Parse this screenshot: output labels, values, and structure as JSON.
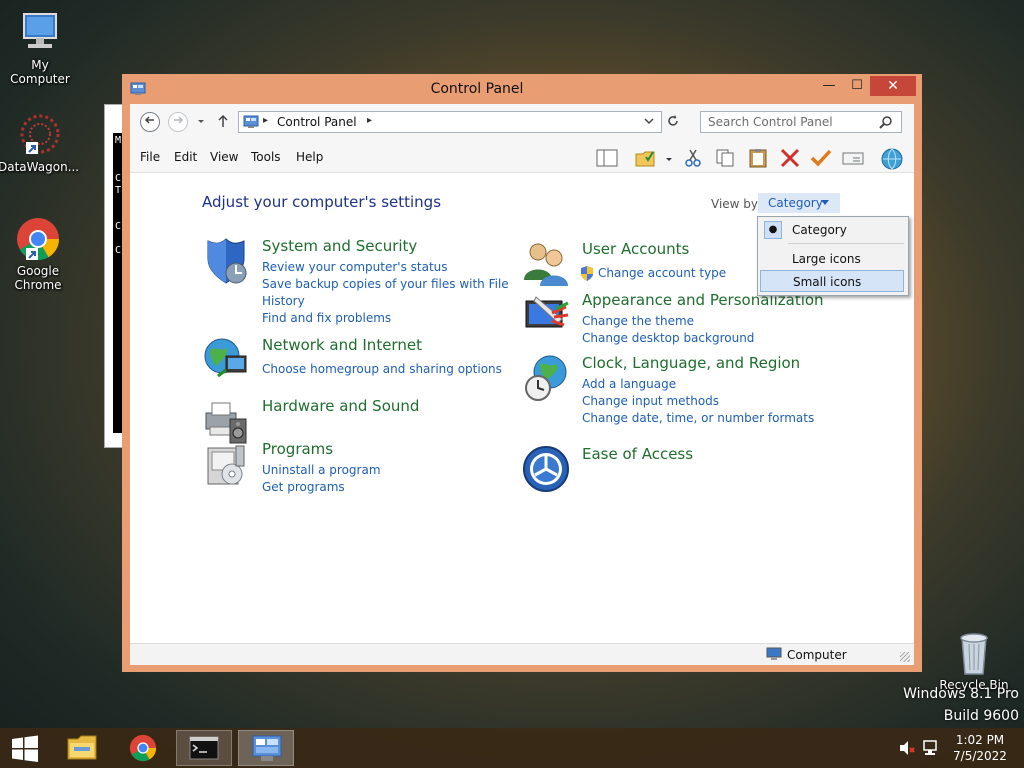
{
  "desktop": {
    "icons": [
      {
        "label": "My Computer"
      },
      {
        "label": "DataWagon..."
      },
      {
        "label_line1": "Google",
        "label_line2": "Chrome"
      },
      {
        "label": "Recycle Bin"
      }
    ],
    "watermark_line1": "Windows 8.1 Pro",
    "watermark_line2": "Build 9600"
  },
  "console_glyphs": [
    "M",
    "C",
    "C",
    "T",
    "C",
    "C"
  ],
  "window": {
    "title": "Control Panel",
    "minimize": "—",
    "maximize": "☐",
    "close": "✕"
  },
  "address_bar": {
    "path": "Control Panel",
    "search_placeholder": "Search Control Panel"
  },
  "menu": [
    "File",
    "Edit",
    "View",
    "Tools",
    "Help"
  ],
  "content": {
    "heading": "Adjust your computer's settings",
    "view_by_label": "View by:",
    "view_by_value": "Category"
  },
  "categories_left": [
    {
      "title": "System and Security",
      "links": [
        "Review your computer's status",
        "Save backup copies of your files with File",
        "History",
        "Find and fix problems"
      ]
    },
    {
      "title": "Network and Internet",
      "links": [
        "Choose homegroup and sharing options"
      ]
    },
    {
      "title": "Hardware and Sound",
      "links": []
    },
    {
      "title": "Programs",
      "links": [
        "Uninstall a program",
        "Get programs"
      ]
    }
  ],
  "categories_right": [
    {
      "title": "User Accounts",
      "links": [
        "Change account type"
      ]
    },
    {
      "title": "Appearance and Personalization",
      "links": [
        "Change the theme",
        "Change desktop background"
      ]
    },
    {
      "title": "Clock, Language, and Region",
      "links": [
        "Add a language",
        "Change input methods",
        "Change date, time, or number formats"
      ]
    },
    {
      "title": "Ease of Access",
      "links": []
    }
  ],
  "view_dropdown": {
    "options": [
      "Category",
      "Large icons",
      "Small icons"
    ],
    "selected": "Category",
    "highlighted": "Small icons"
  },
  "statusbar": {
    "location": "Computer"
  },
  "taskbar": {
    "time": "1:02 PM",
    "date": "7/5/2022"
  },
  "colors": {
    "window_frame": "#e99d72",
    "category_title": "#1e6e2e",
    "link": "#1e5fb4",
    "heading": "#1e3287",
    "close_button": "#c7463a"
  }
}
